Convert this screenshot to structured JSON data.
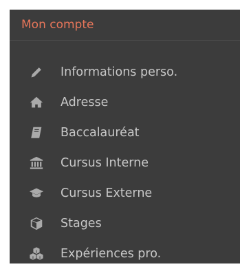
{
  "colors": {
    "panel_bg": "#3c3c3c",
    "header_text": "#e8765a",
    "item_text": "#c8c8c8",
    "icon": "#aaaaaa"
  },
  "menu": {
    "title": "Mon compte",
    "items": [
      {
        "label": "Informations perso.",
        "icon": "pencil-icon"
      },
      {
        "label": "Adresse",
        "icon": "home-icon"
      },
      {
        "label": "Baccalauréat",
        "icon": "book-icon"
      },
      {
        "label": "Cursus Interne",
        "icon": "institution-icon"
      },
      {
        "label": "Cursus Externe",
        "icon": "graduation-cap-icon"
      },
      {
        "label": "Stages",
        "icon": "cube-icon"
      },
      {
        "label": "Expériences pro.",
        "icon": "cubes-icon"
      }
    ]
  }
}
